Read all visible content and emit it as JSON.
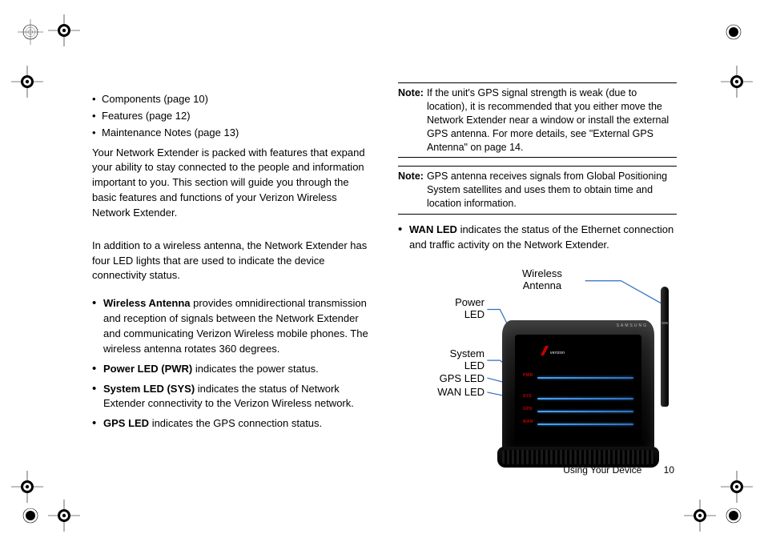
{
  "left": {
    "toc": [
      "Components (page 10)",
      "Features (page 12)",
      "Maintenance Notes (page 13)"
    ],
    "intro": "Your Network Extender is packed with features that expand your ability to stay connected to the people and information important to you. This section will guide you through the basic features and functions of your Verizon Wireless Network Extender.",
    "led_intro": "In addition to a wireless antenna, the Network Extender has four LED lights that are used to indicate the device connectivity status.",
    "items": [
      {
        "b": "Wireless Antenna",
        "t": " provides omnidirectional transmission and reception of signals between the Network Extender and communicating Verizon Wireless mobile phones. The wireless antenna rotates 360 degrees."
      },
      {
        "b": "Power LED (PWR)",
        "t": " indicates the power status."
      },
      {
        "b": "System LED (SYS)",
        "t": " indicates the status of Network Extender connectivity to the Verizon Wireless network."
      },
      {
        "b": "GPS LED",
        "t": " indicates the GPS connection status."
      }
    ]
  },
  "right": {
    "note1": {
      "label": "Note:",
      "text": "If the unit's GPS signal strength is weak (due to location), it is recommended that you either move the Network Extender near a window or install the external GPS antenna. For more details, see \"External GPS Antenna\" on page 14."
    },
    "note2": {
      "label": "Note:",
      "text": "GPS antenna receives signals from Global Positioning System satellites and uses them to obtain time and location information."
    },
    "wan": {
      "b": "WAN LED",
      "t": " indicates the status of the Ethernet connection and traffic activity on the Network Extender."
    },
    "diagram": {
      "wireless1": "Wireless",
      "wireless2": "Antenna",
      "power1": "Power",
      "power2": "LED",
      "system1": "System",
      "system2": "LED",
      "gps": "GPS LED",
      "wan": "WAN LED",
      "led_pwr": "PWR",
      "led_sys": "SYS",
      "led_gps": "GPS",
      "led_wan": "WAN",
      "top_brand": "SAMSUNG",
      "vz": "verizon"
    }
  },
  "footer": {
    "section": "Using Your Device",
    "page": "10"
  }
}
